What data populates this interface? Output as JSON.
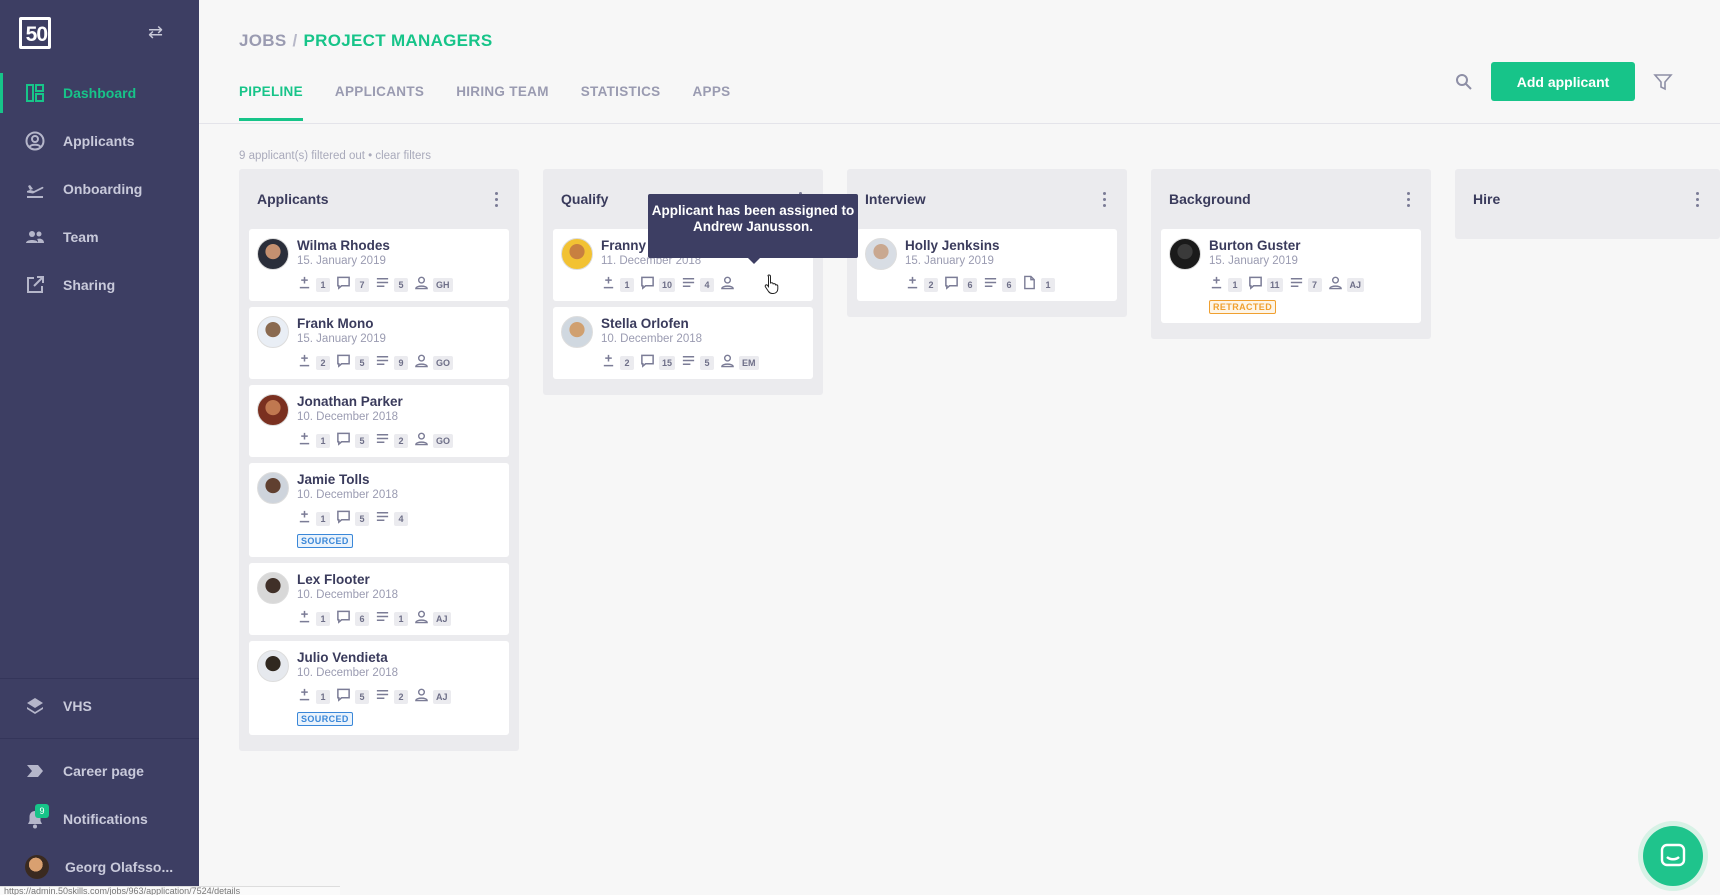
{
  "sidebar": {
    "logo_text": "50",
    "items": [
      {
        "label": "Dashboard",
        "icon": "dashboard-icon",
        "active": true
      },
      {
        "label": "Applicants",
        "icon": "user-circle-icon"
      },
      {
        "label": "Onboarding",
        "icon": "airplane-icon"
      },
      {
        "label": "Team",
        "icon": "team-icon"
      },
      {
        "label": "Sharing",
        "icon": "share-icon"
      }
    ],
    "bottom_items": [
      {
        "label": "VHS",
        "icon": "layers-icon"
      },
      {
        "label": "Career page",
        "icon": "tag-icon"
      },
      {
        "label": "Notifications",
        "icon": "bell-icon",
        "badge": "9"
      },
      {
        "label": "Georg Olafsso...",
        "icon": "avatar"
      }
    ]
  },
  "header": {
    "breadcrumb_root": "JOBS",
    "breadcrumb_sep": "/",
    "breadcrumb_current": "PROJECT MANAGERS",
    "tabs": [
      "PIPELINE",
      "APPLICANTS",
      "HIRING TEAM",
      "STATISTICS",
      "APPS"
    ],
    "active_tab": "PIPELINE",
    "add_button": "Add applicant"
  },
  "filter_note": "9 applicant(s) filtered out • clear filters",
  "tooltip": "Applicant has been assigned to Andrew Janusson.",
  "status_url": "https://admin.50skills.com/jobs/963/application/7524/details",
  "colors": {
    "accent": "#17c489",
    "sidebar": "#3d3e63"
  },
  "columns": [
    {
      "title": "Applicants",
      "cards": [
        {
          "name": "Wilma Rhodes",
          "date": "15. January 2019",
          "votes": "1",
          "comments": "7",
          "notes": "5",
          "assignee": "GH"
        },
        {
          "name": "Frank Mono",
          "date": "15. January 2019",
          "votes": "2",
          "comments": "5",
          "notes": "9",
          "assignee": "GO"
        },
        {
          "name": "Jonathan Parker",
          "date": "10. December 2018",
          "votes": "1",
          "comments": "5",
          "notes": "2",
          "assignee": "GO"
        },
        {
          "name": "Jamie Tolls",
          "date": "10. December 2018",
          "votes": "1",
          "comments": "5",
          "notes": "4",
          "badge": "SOURCED"
        },
        {
          "name": "Lex Flooter",
          "date": "10. December 2018",
          "votes": "1",
          "comments": "6",
          "notes": "1",
          "assignee": "AJ"
        },
        {
          "name": "Julio Vendieta",
          "date": "10. December 2018",
          "votes": "1",
          "comments": "5",
          "notes": "2",
          "assignee": "AJ",
          "badge": "SOURCED"
        }
      ]
    },
    {
      "title": "Qualify",
      "cards": [
        {
          "name": "Franny",
          "date": "11. December 2018",
          "votes": "1",
          "comments": "10",
          "notes": "4"
        },
        {
          "name": "Stella Orlofen",
          "date": "10. December 2018",
          "votes": "2",
          "comments": "15",
          "notes": "5",
          "assignee": "EM"
        }
      ]
    },
    {
      "title": "Interview",
      "cards": [
        {
          "name": "Holly Jenksins",
          "date": "15. January 2019",
          "votes": "2",
          "comments": "6",
          "notes": "6",
          "files": "1"
        }
      ]
    },
    {
      "title": "Background",
      "cards": [
        {
          "name": "Burton Guster",
          "date": "15. January 2019",
          "votes": "1",
          "comments": "11",
          "notes": "7",
          "assignee": "AJ",
          "badge": "RETRACTED"
        }
      ]
    },
    {
      "title": "Hire",
      "cards": []
    }
  ]
}
